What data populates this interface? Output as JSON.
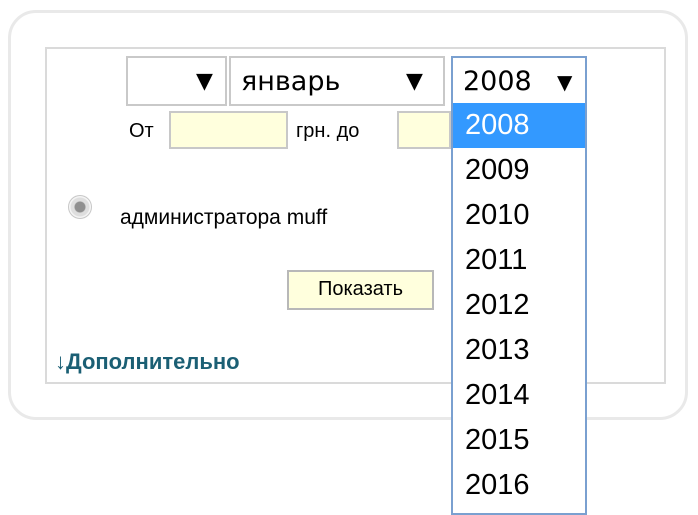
{
  "date_selector": {
    "day": {
      "value": "",
      "arrow": "▼"
    },
    "month": {
      "value": "январь",
      "arrow": "▼"
    },
    "year": {
      "value": "2008",
      "arrow": "▼",
      "options": [
        "2008",
        "2009",
        "2010",
        "2011",
        "2012",
        "2013",
        "2014",
        "2015",
        "2016"
      ],
      "selected_option": "2008"
    }
  },
  "price_filter": {
    "from_label": "От",
    "to_label": "грн. до",
    "from_value": "",
    "to_value": ""
  },
  "author_filter": {
    "label": "администратора muff"
  },
  "actions": {
    "show_label": "Показать",
    "more_label": "↓Дополнительно"
  },
  "colors": {
    "selected_option_bg": "#3399ff",
    "input_bg": "#ffffdd",
    "link": "#1b5f74"
  }
}
